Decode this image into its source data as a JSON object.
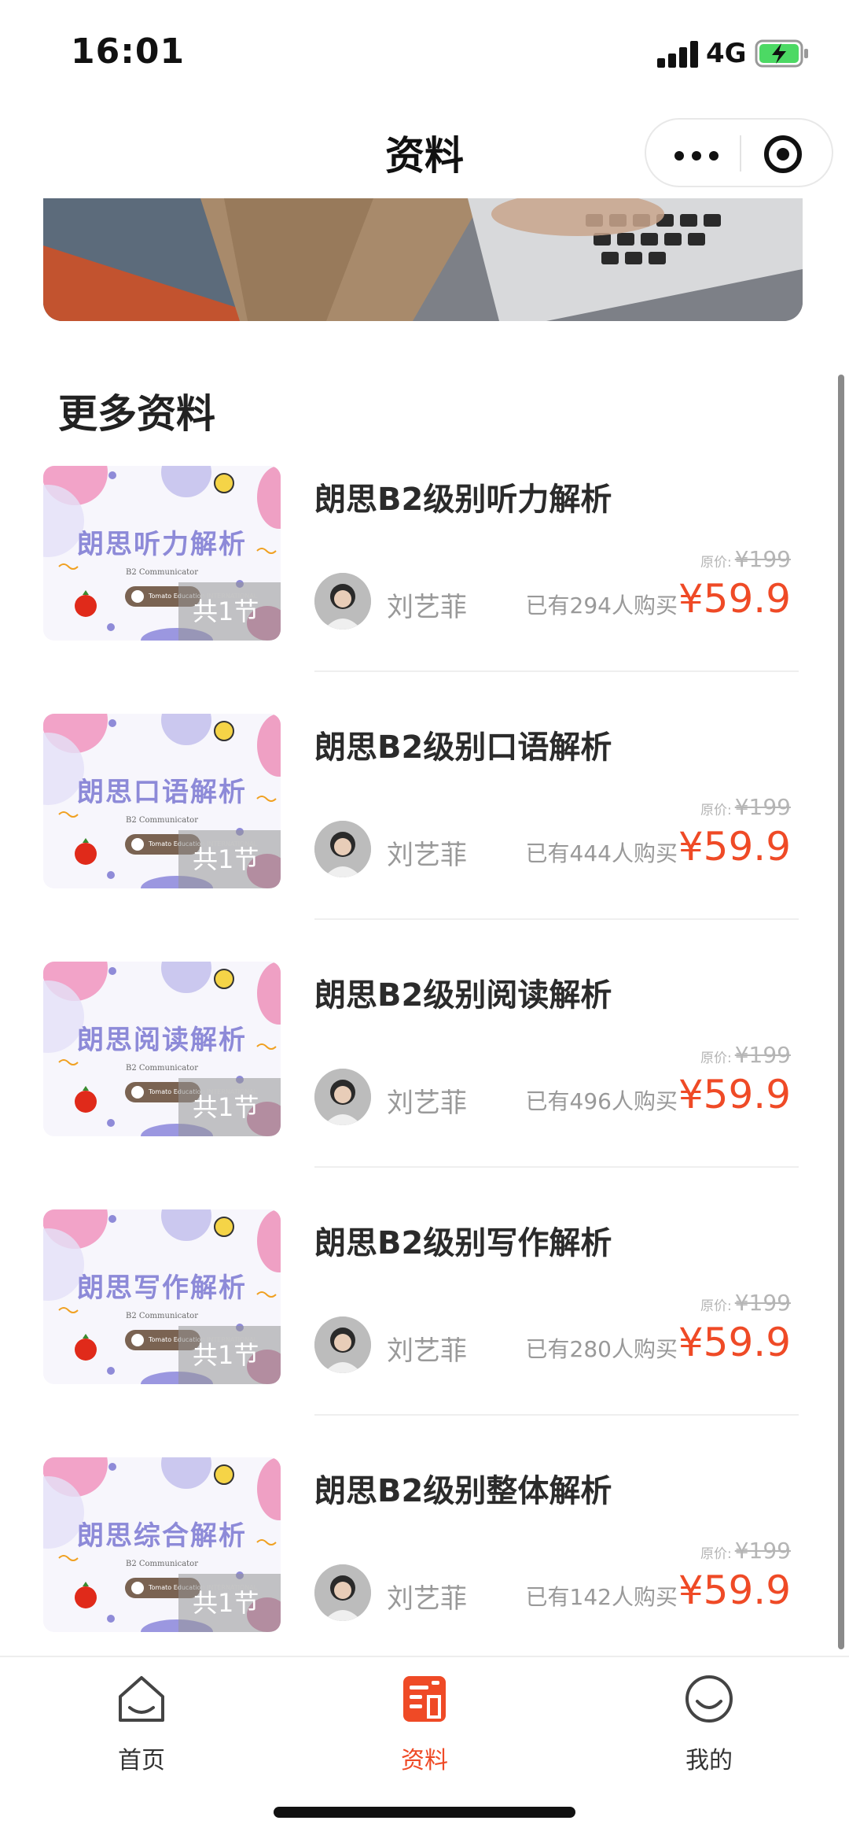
{
  "status_bar": {
    "time": "16:01",
    "network": "4G"
  },
  "nav": {
    "title": "资料"
  },
  "section": {
    "title": "更多资料"
  },
  "products": [
    {
      "thumb_title": "朗思听力解析",
      "thumb_sub": "B2 Communicator",
      "brand": "Tomato Education INTERNATIONAL",
      "lessons": "共1节",
      "title": "朗思B2级别听力解析",
      "author": "刘艺菲",
      "orig_label": "原价:",
      "orig_price": "¥199",
      "sold": "已有294人购买",
      "price": "¥59.9"
    },
    {
      "thumb_title": "朗思口语解析",
      "thumb_sub": "B2 Communicator",
      "brand": "Tomato Education INTERNATIONAL",
      "lessons": "共1节",
      "title": "朗思B2级别口语解析",
      "author": "刘艺菲",
      "orig_label": "原价:",
      "orig_price": "¥199",
      "sold": "已有444人购买",
      "price": "¥59.9"
    },
    {
      "thumb_title": "朗思阅读解析",
      "thumb_sub": "B2 Communicator",
      "brand": "Tomato Education INTERNATIONAL",
      "lessons": "共1节",
      "title": "朗思B2级别阅读解析",
      "author": "刘艺菲",
      "orig_label": "原价:",
      "orig_price": "¥199",
      "sold": "已有496人购买",
      "price": "¥59.9"
    },
    {
      "thumb_title": "朗思写作解析",
      "thumb_sub": "B2 Communicator",
      "brand": "Tomato Education INTERNATIONAL",
      "lessons": "共1节",
      "title": "朗思B2级别写作解析",
      "author": "刘艺菲",
      "orig_label": "原价:",
      "orig_price": "¥199",
      "sold": "已有280人购买",
      "price": "¥59.9"
    },
    {
      "thumb_title": "朗思综合解析",
      "thumb_sub": "B2 Communicator",
      "brand": "Tomato Education INTERNATIONAL",
      "lessons": "共1节",
      "title": "朗思B2级别整体解析",
      "author": "刘艺菲",
      "orig_label": "原价:",
      "orig_price": "¥199",
      "sold": "已有142人购买",
      "price": "¥59.9"
    }
  ],
  "tabs": [
    {
      "label": "首页",
      "icon": "home-icon",
      "active": false
    },
    {
      "label": "资料",
      "icon": "document-icon",
      "active": true
    },
    {
      "label": "我的",
      "icon": "smile-icon",
      "active": false
    }
  ],
  "colors": {
    "accent": "#ef4a26",
    "thumb_title": "#8d8ad8"
  }
}
